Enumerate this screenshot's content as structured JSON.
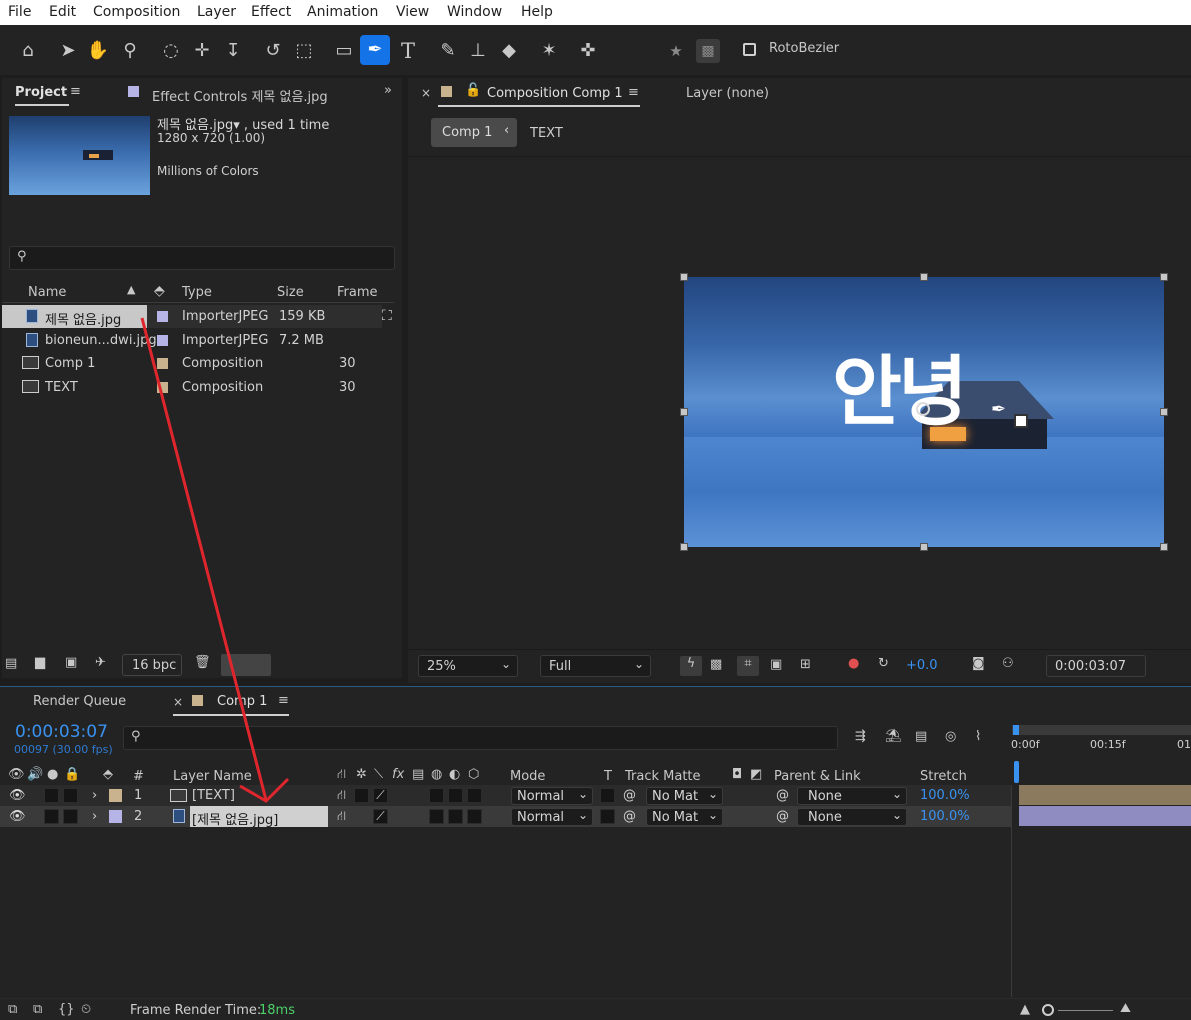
{
  "menu": [
    "File",
    "Edit",
    "Composition",
    "Layer",
    "Effect",
    "Animation",
    "View",
    "Window",
    "Help"
  ],
  "toolbar": {
    "rotobezier_label": "RotoBezier"
  },
  "project": {
    "tab_label": "Project",
    "effect_tab_label": "Effect Controls 제목 없음.jpg",
    "selected_name": "제목 없음.jpg▾ , used 1 time",
    "selected_dims": "1280 x 720 (1.00)",
    "selected_colors": "Millions of Colors",
    "search_placeholder": "",
    "columns": {
      "name": "Name",
      "type": "Type",
      "size": "Size",
      "frame": "Frame ..."
    },
    "items": [
      {
        "name": "제목 없음.jpg",
        "type": "ImporterJPEG",
        "size": "159 KB",
        "frame": "",
        "kind": "file",
        "label_color": "#b6b3e6"
      },
      {
        "name": "bioneun...dwi.jpg",
        "type": "ImporterJPEG",
        "size": "7.2 MB",
        "frame": "",
        "kind": "file",
        "label_color": "#b6b3e6"
      },
      {
        "name": "Comp 1",
        "type": "Composition",
        "size": "",
        "frame": "30",
        "kind": "comp",
        "label_color": "#c9b38e"
      },
      {
        "name": "TEXT",
        "type": "Composition",
        "size": "",
        "frame": "30",
        "kind": "comp",
        "label_color": "#c9b38e"
      }
    ],
    "bpc_label": "16 bpc"
  },
  "composition": {
    "tab_label": "Composition Comp 1",
    "layer_tab_label": "Layer (none)",
    "breadcrumb_current": "Comp 1",
    "breadcrumb_next": "TEXT",
    "overlay_text": "안녕",
    "zoom": "25%",
    "resolution": "Full",
    "exposure": "+0.0",
    "timecode": "0:00:03:07"
  },
  "timeline": {
    "render_queue_tab": "Render Queue",
    "comp_tab": "Comp 1",
    "current_time": "0:00:03:07",
    "frame_info": "00097 (30.00 fps)",
    "columns": {
      "num": "#",
      "layer_name": "Layer Name",
      "mode": "Mode",
      "t": "T",
      "track_matte": "Track Matte",
      "parent": "Parent & Link",
      "stretch": "Stretch"
    },
    "ruler": [
      "0:00f",
      "00:15f",
      "01"
    ],
    "layers": [
      {
        "num": "1",
        "name": "[TEXT]",
        "mode": "Normal",
        "matte": "No Mat",
        "parent": "None",
        "stretch": "100.0%",
        "label_color": "#c9b38e",
        "kind": "comp"
      },
      {
        "num": "2",
        "name": "[제목 없음.jpg]",
        "mode": "Normal",
        "matte": "No Mat",
        "parent": "None",
        "stretch": "100.0%",
        "label_color": "#b6b3e6",
        "kind": "file"
      }
    ],
    "render_time_label": "Frame Render Time:",
    "render_time_value": "18ms"
  }
}
